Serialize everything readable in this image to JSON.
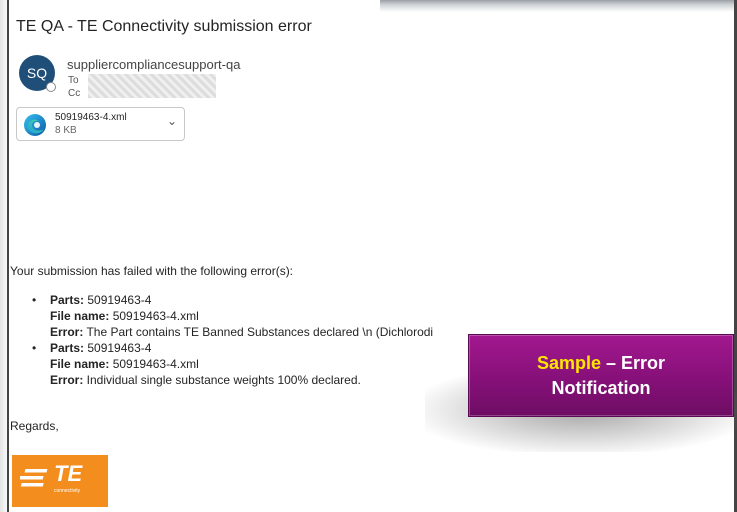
{
  "email": {
    "subject": "TE QA - TE Connectivity submission error",
    "sender_initials": "SQ",
    "sender_name": "suppliercompliancesupport-qa",
    "to_label": "To",
    "cc_label": "Cc"
  },
  "attachment": {
    "file_name": "50919463-4.xml",
    "file_size": "8 KB",
    "icon": "edge-browser-icon"
  },
  "body": {
    "intro": "Your submission has failed with the following error(s):",
    "errors": [
      {
        "parts_label": "Parts:",
        "parts_value": " 50919463-4",
        "file_label": "File name:",
        "file_value": " 50919463-4.xml",
        "error_label": "Error:",
        "error_value": " The Part contains TE Banned Substances declared \\n (Dichlorodi"
      },
      {
        "parts_label": "Parts:",
        "parts_value": " 50919463-4",
        "file_label": "File name:",
        "file_value": " 50919463-4.xml",
        "error_label": "Error:",
        "error_value": " Individual single substance weights 100% declared."
      }
    ],
    "closing": "Regards,"
  },
  "logo": {
    "text": "TE",
    "subtext": "connectivity"
  },
  "callout": {
    "highlight": "Sample",
    "rest": " – Error",
    "line2": "Notification",
    "highlight_color": "#ffe600",
    "background": "#861079"
  }
}
